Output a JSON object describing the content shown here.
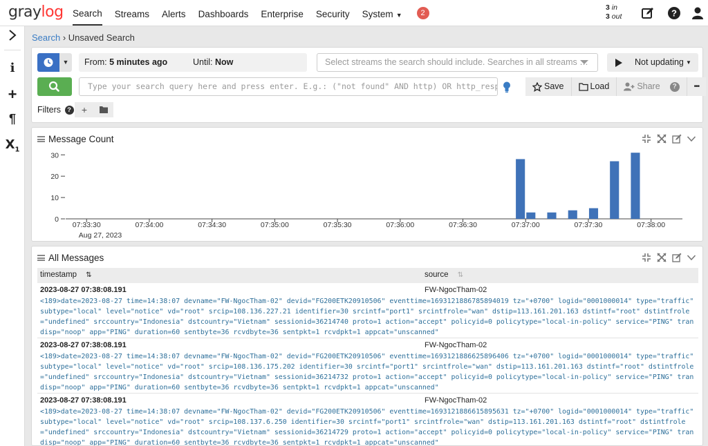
{
  "app": {
    "logo_prefix": "gray",
    "logo_suffix": "log"
  },
  "nav": {
    "items": [
      {
        "label": "Search",
        "active": true
      },
      {
        "label": "Streams"
      },
      {
        "label": "Alerts"
      },
      {
        "label": "Dashboards"
      },
      {
        "label": "Enterprise"
      },
      {
        "label": "Security"
      },
      {
        "label": "System",
        "dropdown": true
      }
    ],
    "notification_count": "2",
    "throughput_in": "3",
    "throughput_in_label": "in",
    "throughput_out": "3",
    "throughput_out_label": "out",
    "icons": [
      "edit-icon",
      "help-icon",
      "user-icon"
    ]
  },
  "sidebar": {
    "icons": [
      "expand-icon",
      "info-icon",
      "plus-icon",
      "paragraph-icon",
      "subscript-icon"
    ]
  },
  "breadcrumb": {
    "link": "Search",
    "separator": "›",
    "current": "Unsaved Search"
  },
  "search": {
    "from_label": "From:",
    "from_value": "5 minutes ago",
    "until_label": "Until:",
    "until_value": "Now",
    "streams_placeholder": "Select streams the search should include. Searches in all streams …",
    "refresh_label": "Not updating",
    "query_placeholder": "Type your search query here and press enter. E.g.: (\"not found\" AND http) OR http_respon…",
    "save_label": "Save",
    "load_label": "Load",
    "share_label": "Share",
    "more_label": "•••",
    "filters_label": "Filters"
  },
  "message_count": {
    "title": "Message Count",
    "chart_data": {
      "type": "bar",
      "title": "Message Count",
      "xlabel": "",
      "ylabel": "",
      "ylim": [
        0,
        33
      ],
      "yticks": [
        0,
        10,
        20,
        30
      ],
      "xticks": [
        "07:33:30",
        "07:34:00",
        "07:34:30",
        "07:35:00",
        "07:35:30",
        "07:36:00",
        "07:36:30",
        "07:37:00",
        "07:37:30",
        "07:38:00"
      ],
      "date_label": "Aug 27, 2023",
      "x_start": "07:33:20",
      "x_end": "07:38:15",
      "bucket_seconds": 5,
      "bars": [
        {
          "start": "07:36:55",
          "value": 28
        },
        {
          "start": "07:37:00",
          "value": 3
        },
        {
          "start": "07:37:10",
          "value": 3
        },
        {
          "start": "07:37:20",
          "value": 4
        },
        {
          "start": "07:37:30",
          "value": 5
        },
        {
          "start": "07:37:40",
          "value": 27
        },
        {
          "start": "07:37:50",
          "value": 31
        }
      ],
      "color": "#3f72b8",
      "grid": false
    }
  },
  "all_messages": {
    "title": "All Messages",
    "columns": [
      "timestamp",
      "source"
    ],
    "rows": [
      {
        "timestamp": "2023-08-27 07:38:08.191",
        "source": "FW-NgocTham-02",
        "message": "<189>date=2023-08-27 time=14:38:07 devname=\"FW-NgocTham-02\" devid=\"FG200ETK20910506\" eventtime=1693121886785894019 tz=\"+0700\" logid=\"0001000014\" type=\"traffic\" subtype=\"local\" level=\"notice\" vd=\"root\" srcip=108.136.227.21 identifier=30 srcintf=\"port1\" srcintfrole=\"wan\" dstip=113.161.201.163 dstintf=\"root\" dstintfrole=\"undefined\" srccountry=\"Indonesia\" dstcountry=\"Vietnam\" sessionid=36214740 proto=1 action=\"accept\" policyid=0 policytype=\"local-in-policy\" service=\"PING\" trandisp=\"noop\" app=\"PING\" duration=60 sentbyte=36 rcvdbyte=36 sentpkt=1 rcvdpkt=1 appcat=\"unscanned\""
      },
      {
        "timestamp": "2023-08-27 07:38:08.191",
        "source": "FW-NgocTham-02",
        "message": "<189>date=2023-08-27 time=14:38:07 devname=\"FW-NgocTham-02\" devid=\"FG200ETK20910506\" eventtime=1693121886625896406 tz=\"+0700\" logid=\"0001000014\" type=\"traffic\" subtype=\"local\" level=\"notice\" vd=\"root\" srcip=108.136.175.202 identifier=30 srcintf=\"port1\" srcintfrole=\"wan\" dstip=113.161.201.163 dstintf=\"root\" dstintfrole=\"undefined\" srccountry=\"Indonesia\" dstcountry=\"Vietnam\" sessionid=36214732 proto=1 action=\"accept\" policyid=0 policytype=\"local-in-policy\" service=\"PING\" trandisp=\"noop\" app=\"PING\" duration=60 sentbyte=36 rcvdbyte=36 sentpkt=1 rcvdpkt=1 appcat=\"unscanned\""
      },
      {
        "timestamp": "2023-08-27 07:38:08.191",
        "source": "FW-NgocTham-02",
        "message": "<189>date=2023-08-27 time=14:38:07 devname=\"FW-NgocTham-02\" devid=\"FG200ETK20910506\" eventtime=1693121886615895631 tz=\"+0700\" logid=\"0001000014\" type=\"traffic\" subtype=\"local\" level=\"notice\" vd=\"root\" srcip=108.137.6.250 identifier=30 srcintf=\"port1\" srcintfrole=\"wan\" dstip=113.161.201.163 dstintf=\"root\" dstintfrole=\"undefined\" srccountry=\"Indonesia\" dstcountry=\"Vietnam\" sessionid=36214729 proto=1 action=\"accept\" policyid=0 policytype=\"local-in-policy\" service=\"PING\" trandisp=\"noop\" app=\"PING\" duration=60 sentbyte=36 rcvdbyte=36 sentpkt=1 rcvdpkt=1 appcat=\"unscanned\""
      }
    ]
  }
}
